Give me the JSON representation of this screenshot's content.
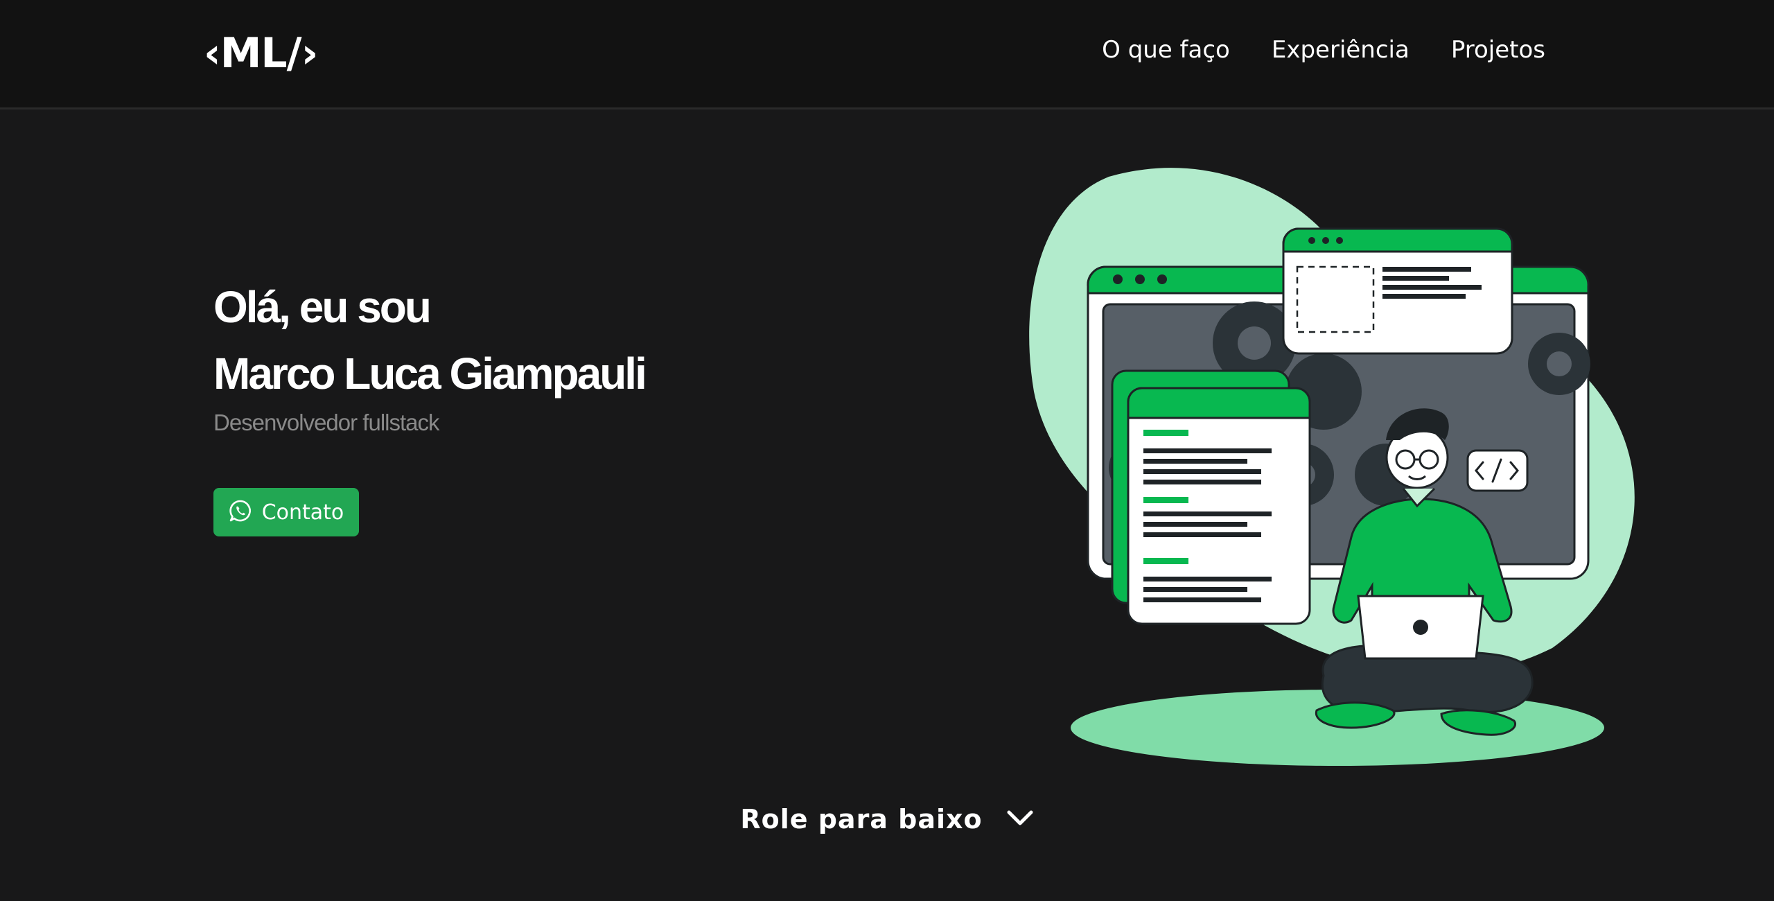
{
  "header": {
    "logo": "‹ML/›",
    "nav": [
      {
        "label": "O que faço"
      },
      {
        "label": "Experiência"
      },
      {
        "label": "Projetos"
      }
    ]
  },
  "hero": {
    "greeting": "Olá, eu sou",
    "name": "Marco Luca Giampauli",
    "role": "Desenvolvedor fullstack",
    "contact_label": "Contato"
  },
  "scroll_hint": {
    "label": "Role para baixo"
  },
  "colors": {
    "background": "#181819",
    "header": "#121212",
    "accent": "#22a753",
    "illustration_green": "#08b850",
    "illustration_light_green": "#b2ebcc",
    "muted_text": "#8a8a8a"
  },
  "icons": {
    "contact": "whatsapp-icon",
    "scroll": "chevron-down-icon"
  }
}
